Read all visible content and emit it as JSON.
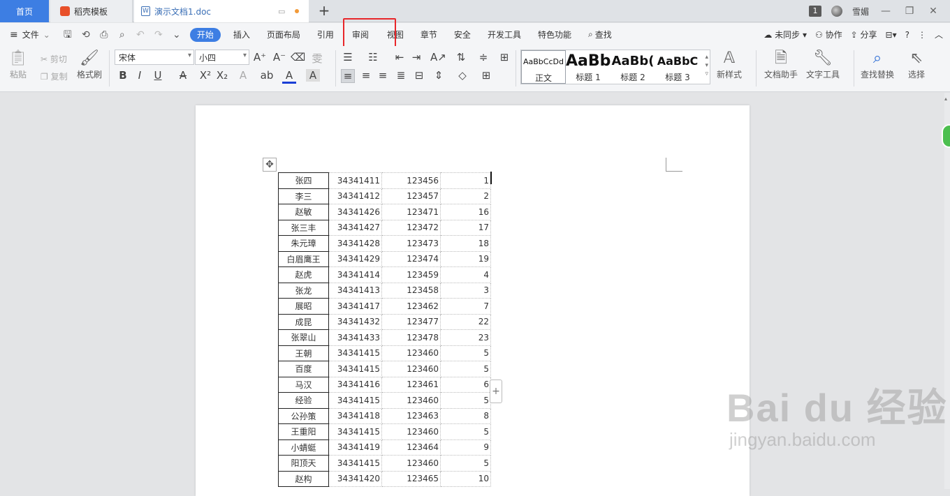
{
  "tabs": {
    "home": "首页",
    "daoke": "稻壳模板",
    "doc": "演示文档1.doc",
    "add": "+"
  },
  "titlebar": {
    "window_count": "1",
    "user": "雪媚"
  },
  "menu": {
    "file": "文件",
    "items": [
      "开始",
      "插入",
      "页面布局",
      "引用",
      "审阅",
      "视图",
      "章节",
      "安全",
      "开发工具",
      "特色功能"
    ],
    "search": "查找",
    "unsynced": "未同步",
    "collab": "协作",
    "share": "分享",
    "help": "?"
  },
  "ribbon": {
    "paste": "粘贴",
    "cut": "剪切",
    "copy": "复制",
    "format_painter": "格式刷",
    "font_name": "宋体",
    "font_size": "小四",
    "styles": [
      {
        "sample": "AaBbCcDd",
        "label": "正文"
      },
      {
        "sample": "AaBb",
        "label": "标题 1"
      },
      {
        "sample": "AaBb(",
        "label": "标题 2"
      },
      {
        "sample": "AaBbC",
        "label": "标题 3"
      }
    ],
    "new_style": "新样式",
    "doc_helper": "文档助手",
    "text_tools": "文字工具",
    "find_replace": "查找替换",
    "select": "选择"
  },
  "table": {
    "rows": [
      [
        "张四",
        "34341411",
        "123456",
        "1"
      ],
      [
        "李三",
        "34341412",
        "123457",
        "2"
      ],
      [
        "赵敏",
        "34341426",
        "123471",
        "16"
      ],
      [
        "张三丰",
        "34341427",
        "123472",
        "17"
      ],
      [
        "朱元璋",
        "34341428",
        "123473",
        "18"
      ],
      [
        "白眉鹰王",
        "34341429",
        "123474",
        "19"
      ],
      [
        "赵虎",
        "34341414",
        "123459",
        "4"
      ],
      [
        "张龙",
        "34341413",
        "123458",
        "3"
      ],
      [
        "展昭",
        "34341417",
        "123462",
        "7"
      ],
      [
        "成昆",
        "34341432",
        "123477",
        "22"
      ],
      [
        "张翠山",
        "34341433",
        "123478",
        "23"
      ],
      [
        "王朝",
        "34341415",
        "123460",
        "5"
      ],
      [
        "百度",
        "34341415",
        "123460",
        "5"
      ],
      [
        "马汉",
        "34341416",
        "123461",
        "6"
      ],
      [
        "经验",
        "34341415",
        "123460",
        "5"
      ],
      [
        "公孙策",
        "34341418",
        "123463",
        "8"
      ],
      [
        "王重阳",
        "34341415",
        "123460",
        "5"
      ],
      [
        "小蜻蜓",
        "34341419",
        "123464",
        "9"
      ],
      [
        "阳顶天",
        "34341415",
        "123460",
        "5"
      ],
      [
        "赵构",
        "34341420",
        "123465",
        "10"
      ]
    ]
  },
  "watermark": {
    "line1": "Bai du 经验",
    "line2": "jingyan.baidu.com"
  }
}
